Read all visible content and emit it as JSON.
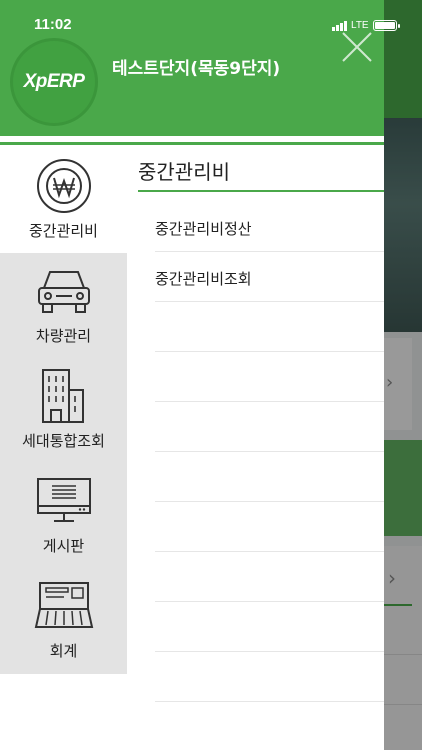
{
  "status_bar": {
    "time": "11:02",
    "network": "LTE"
  },
  "header": {
    "logo_text": "XpERP",
    "complex_name": "테스트단지(목동9단지)"
  },
  "nav": {
    "items": [
      {
        "label": "중간관리비",
        "icon": "won-coin-icon",
        "active": true
      },
      {
        "label": "차량관리",
        "icon": "car-icon",
        "active": false
      },
      {
        "label": "세대통합조회",
        "icon": "building-icon",
        "active": false
      },
      {
        "label": "게시판",
        "icon": "monitor-icon",
        "active": false
      },
      {
        "label": "회계",
        "icon": "register-icon",
        "active": false
      }
    ]
  },
  "section": {
    "title": "중간관리비",
    "items": [
      {
        "label": "중간관리비정산"
      },
      {
        "label": "중간관리비조회"
      },
      {
        "label": ""
      },
      {
        "label": ""
      },
      {
        "label": ""
      },
      {
        "label": ""
      },
      {
        "label": ""
      },
      {
        "label": ""
      },
      {
        "label": ""
      },
      {
        "label": ""
      },
      {
        "label": ""
      }
    ]
  },
  "colors": {
    "accent_green": "#4aa84a",
    "nav_background": "#e3e3e3"
  }
}
